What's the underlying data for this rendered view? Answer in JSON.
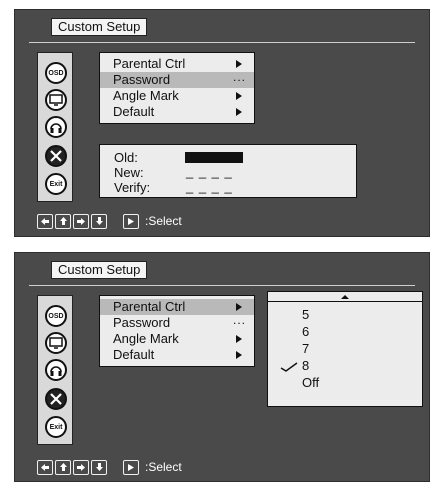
{
  "title": "Custom Setup",
  "side_icons": [
    {
      "name": "osd-icon",
      "label": "OSD"
    },
    {
      "name": "display-icon",
      "label": ""
    },
    {
      "name": "audio-icon",
      "label": ""
    },
    {
      "name": "setup-tools-icon",
      "label": ""
    },
    {
      "name": "exit-icon",
      "label": "Exit"
    }
  ],
  "menu": {
    "items": [
      {
        "label": "Parental Ctrl",
        "indicator": "arrow"
      },
      {
        "label": "Password",
        "indicator": "dots"
      },
      {
        "label": "Angle Mark",
        "indicator": "arrow"
      },
      {
        "label": "Default",
        "indicator": "arrow"
      }
    ],
    "dots": "..."
  },
  "password": {
    "old_label": "Old:",
    "new_label": "New:",
    "verify_label": "Verify:",
    "new_value": "_ _ _ _",
    "verify_value": "_ _ _ _"
  },
  "parental_options": {
    "options": [
      "5",
      "6",
      "7",
      "8",
      "Off"
    ],
    "selected": "8"
  },
  "nav": {
    "select_label": ":Select"
  },
  "colors": {
    "panel_bg": "#4a4a4a",
    "menu_bg": "#ececec",
    "highlight": "#b9b9b9"
  }
}
